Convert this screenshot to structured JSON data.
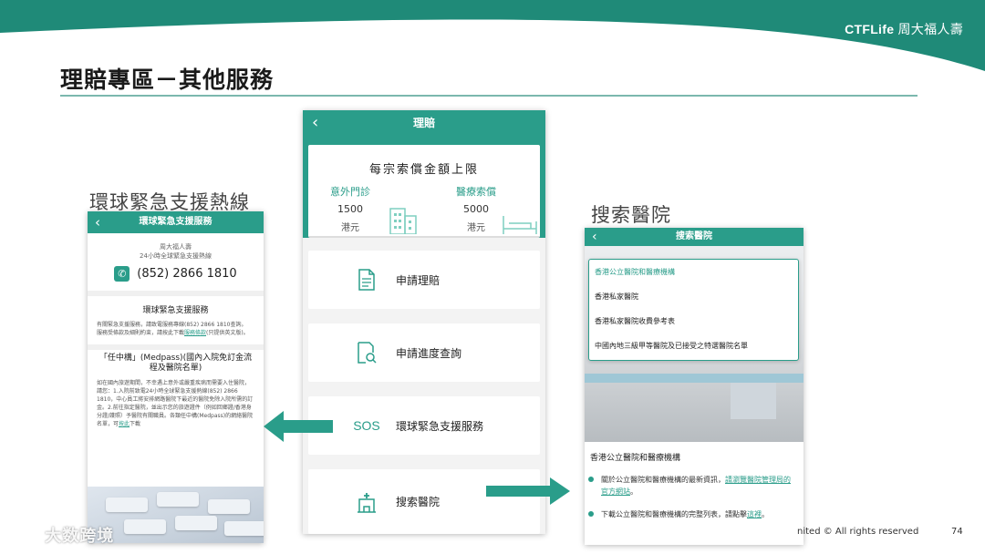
{
  "brand": {
    "name_latin": "CTFLife",
    "name_cn": "周大福人壽"
  },
  "slide": {
    "title": "理賠專區－其他服務",
    "page_number": "74",
    "copyright": "nited © All rights reserved"
  },
  "captions": {
    "left": "環球緊急支援熱線",
    "right": "搜索醫院"
  },
  "left_phone": {
    "header_title": "環球緊急支援服務",
    "back_icon": "chevron-left-icon",
    "company": "周大福人壽",
    "hotline_label": "24小時全球緊急支援熱線",
    "phone_number": "(852) 2866 1810",
    "section1_title": "環球緊急支援服務",
    "section1_body_1": "有關緊急支援服務，請致電服務專線(852) 2866 1810查詢。",
    "section1_body_2a": "服務受條款及細則約束，請按此下載",
    "section1_body_link": "服務條款",
    "section1_body_2b": "(只提供英文版)。",
    "section2_title": "「任中構」(Medpass)(國內入院免訂金流程及醫院名單)",
    "section2_body": "如在國內旅遊期間，不幸遇上意外或嚴重疾病而需要入住醫院，請您：1.入院前致電24小時全球緊急支援熱線(852) 2866 1810，中心員工將安排網路醫院下最近的醫院免除入院所需的訂金。2.前往指定醫院，並出示您的旅遊證件（例如回鄉證/香港身分證/護照）予醫院有關職員。各類任中構(Medpass)的網絡醫院名單，可",
    "section2_link": "按此",
    "section2_tail": "下載"
  },
  "mid_phone": {
    "header_title": "理賠",
    "card_title": "每宗索償金額上限",
    "col1": {
      "label": "意外門診",
      "value": "1500",
      "unit": "港元"
    },
    "col2": {
      "label": "醫療索償",
      "value": "5000",
      "unit": "港元"
    },
    "items": [
      {
        "label": "申請理賠",
        "icon": "document-icon"
      },
      {
        "label": "申請進度查詢",
        "icon": "search-document-icon"
      },
      {
        "label": "環球緊急支援服務",
        "icon": "sos-icon",
        "icon_text": "SOS"
      },
      {
        "label": "搜索醫院",
        "icon": "hospital-icon"
      }
    ]
  },
  "right_phone": {
    "header_title": "搜索醫院",
    "dropdown_options": [
      "香港公立醫院和醫療機構",
      "香港私家醫院",
      "香港私家醫院收費參考表",
      "中國內地三級甲等醫院及已接受之特選醫院名單"
    ],
    "content_heading": "香港公立醫院和醫療機構",
    "bullet1_text": "關於公立醫院和醫療機構的最新資訊，",
    "bullet1_link": "請瀏覽醫院管理局的官方網站",
    "bullet1_tail": "。",
    "bullet2_text": "下載公立醫院和醫療機構的完整列表，請點擊",
    "bullet2_link": "這裡",
    "bullet2_tail": "。"
  },
  "watermark": {
    "text": "大数跨境"
  },
  "colors": {
    "teal": "#2a9d8a",
    "teal_dark": "#1f8a78",
    "title_line": "#7bb8ae"
  }
}
